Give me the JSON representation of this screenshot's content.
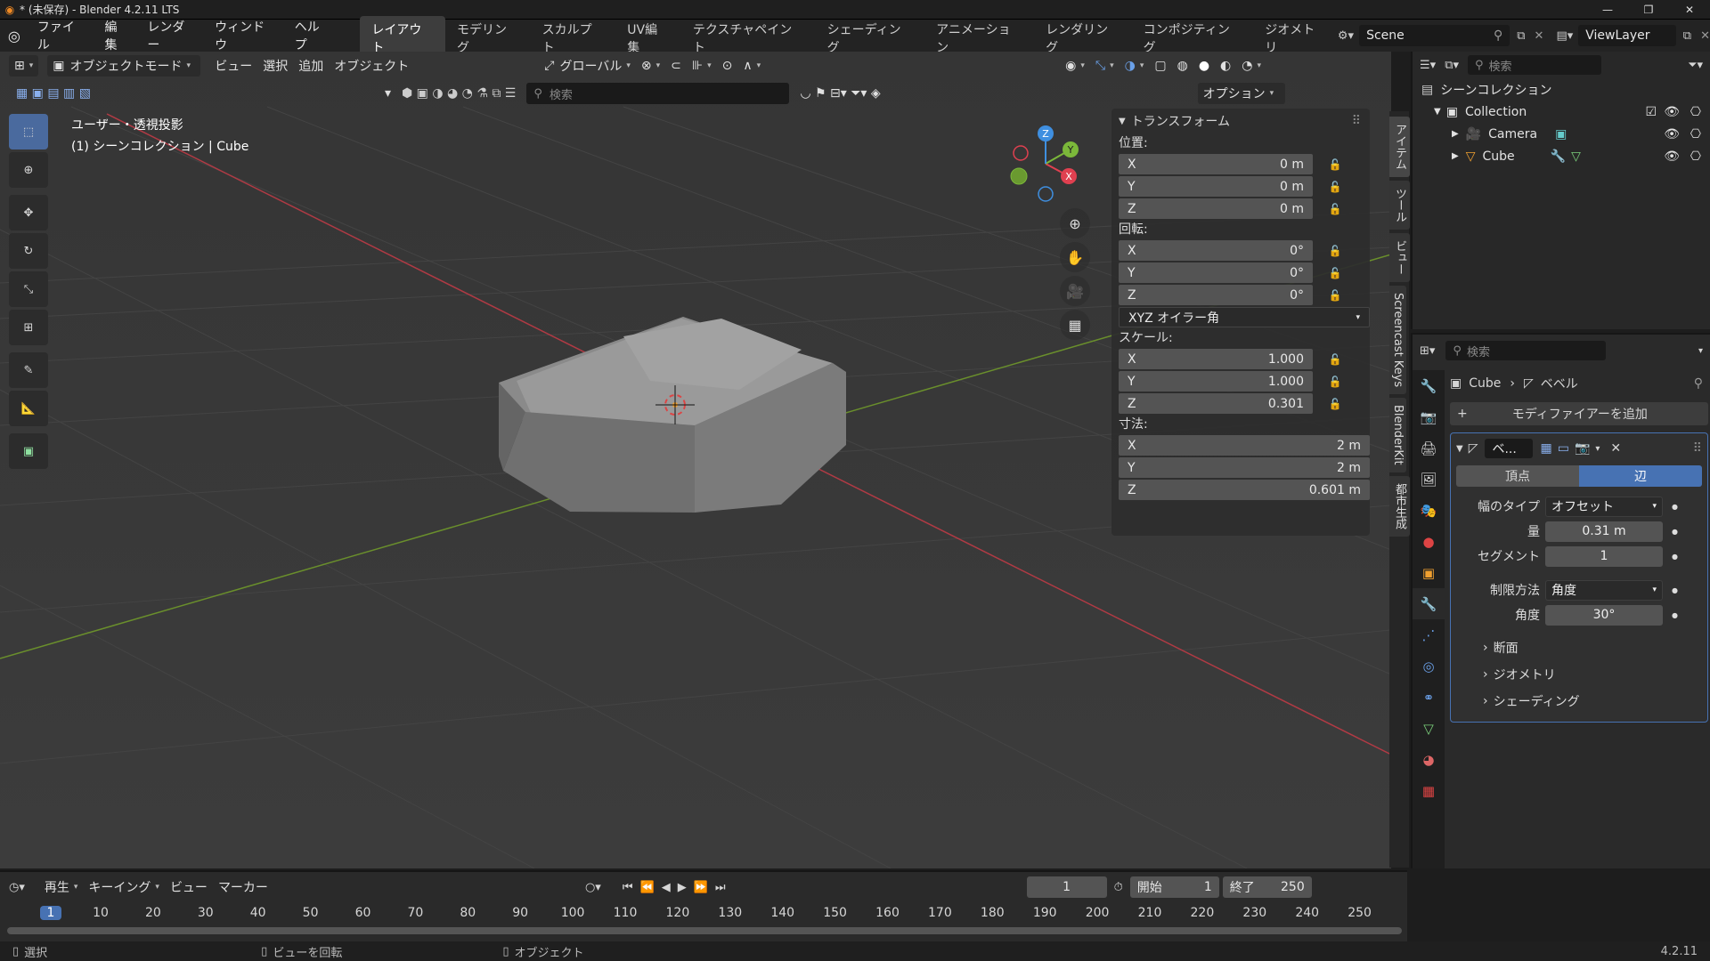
{
  "window": {
    "title": "* (未保存) - Blender 4.2.11 LTS",
    "controls": [
      "—",
      "❐",
      "✕"
    ]
  },
  "menus": [
    "ファイル",
    "編集",
    "レンダー",
    "ウィンドウ",
    "ヘルプ"
  ],
  "workspaces": [
    "レイアウト",
    "モデリング",
    "スカルプト",
    "UV編集",
    "テクスチャペイント",
    "シェーディング",
    "アニメーション",
    "レンダリング",
    "コンポジティング",
    "ジオメトリ"
  ],
  "scene": {
    "name": "Scene",
    "view_layer": "ViewLayer"
  },
  "viewport_header": {
    "mode": "オブジェクトモード",
    "menus": [
      "ビュー",
      "選択",
      "追加",
      "オブジェクト"
    ],
    "orientation": "グローバル",
    "search_placeholder": "検索",
    "options": "オプション"
  },
  "viewport_info": {
    "line1": "ユーザー・透視投影",
    "line2": "(1) シーンコレクション | Cube"
  },
  "gizmo_axes": {
    "x": "X",
    "y": "Y",
    "z": "Z"
  },
  "npanel": {
    "header": "トランスフォーム",
    "location_label": "位置:",
    "location": [
      {
        "axis": "X",
        "value": "0 m"
      },
      {
        "axis": "Y",
        "value": "0 m"
      },
      {
        "axis": "Z",
        "value": "0 m"
      }
    ],
    "rotation_label": "回転:",
    "rotation": [
      {
        "axis": "X",
        "value": "0°"
      },
      {
        "axis": "Y",
        "value": "0°"
      },
      {
        "axis": "Z",
        "value": "0°"
      }
    ],
    "rotation_mode": "XYZ オイラー角",
    "scale_label": "スケール:",
    "scale": [
      {
        "axis": "X",
        "value": "1.000"
      },
      {
        "axis": "Y",
        "value": "1.000"
      },
      {
        "axis": "Z",
        "value": "0.301"
      }
    ],
    "dimensions_label": "寸法:",
    "dimensions": [
      {
        "axis": "X",
        "value": "2 m"
      },
      {
        "axis": "Y",
        "value": "2 m"
      },
      {
        "axis": "Z",
        "value": "0.601 m"
      }
    ]
  },
  "side_tabs": [
    "アイテム",
    "ツール",
    "ビュー",
    "Screencast Keys",
    "BlenderKit",
    "都市生成"
  ],
  "outliner": {
    "search_placeholder": "検索",
    "root": "シーンコレクション",
    "collection": "Collection",
    "items": [
      "Camera",
      "Cube"
    ]
  },
  "properties": {
    "search_placeholder": "検索",
    "breadcrumb_object": "Cube",
    "breadcrumb_modifier": "ベベル",
    "add_modifier": "モディファイアーを追加",
    "modifier_name": "ベ...",
    "toggle_vertices": "頂点",
    "toggle_edges": "辺",
    "width_type_label": "幅のタイプ",
    "width_type": "オフセット",
    "amount_label": "量",
    "amount": "0.31 m",
    "segments_label": "セグメント",
    "segments": "1",
    "limit_method_label": "制限方法",
    "limit_method": "角度",
    "angle_label": "角度",
    "angle": "30°",
    "subpanels": [
      "断面",
      "ジオメトリ",
      "シェーディング"
    ]
  },
  "timeline": {
    "menus": [
      "再生",
      "キーイング",
      "ビュー",
      "マーカー"
    ],
    "current_frame": "1",
    "start_label": "開始",
    "start": "1",
    "end_label": "終了",
    "end": "250",
    "ticks": [
      "1",
      "10",
      "20",
      "30",
      "40",
      "50",
      "60",
      "70",
      "80",
      "90",
      "100",
      "110",
      "120",
      "130",
      "140",
      "150",
      "160",
      "170",
      "180",
      "190",
      "200",
      "210",
      "220",
      "230",
      "240",
      "250"
    ]
  },
  "statusbar": {
    "select": "選択",
    "rotate_view": "ビューを回転",
    "object": "オブジェクト",
    "version": "4.2.11"
  },
  "colors": {
    "accent": "#4772b3",
    "x_axis": "#e04050",
    "y_axis": "#7bb83a",
    "z_axis": "#3f8fe0"
  }
}
